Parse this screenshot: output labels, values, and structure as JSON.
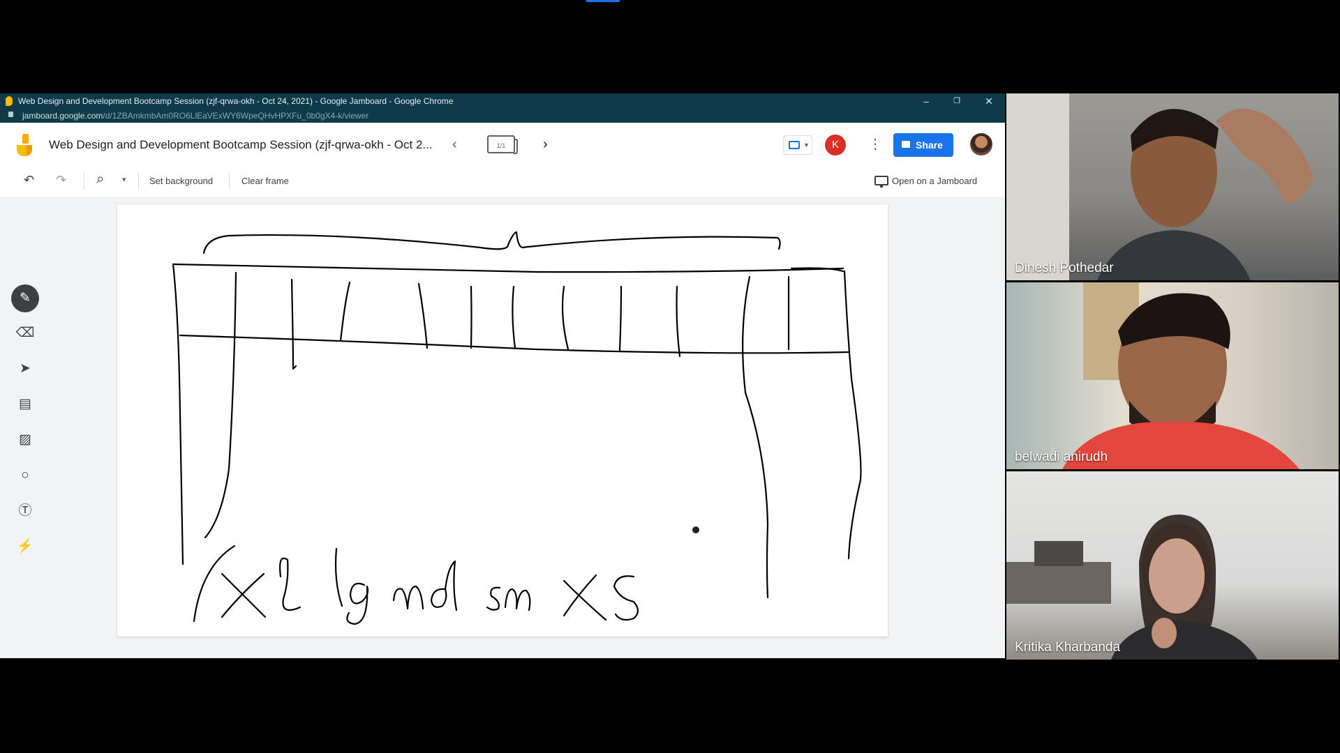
{
  "browser": {
    "window_title": "Web Design and Development Bootcamp Session (zjf-qrwa-okh - Oct 24, 2021) - Google Jamboard - Google Chrome",
    "url_host": "jamboard.google.com",
    "url_path": "/d/1ZBAmkmbAm0RO6LlEaVExWY6WpeQHvHPXFu_0b0gX4-k/viewer",
    "controls": {
      "minimize": "–",
      "restore": "❐",
      "close": "✕"
    }
  },
  "jamboard": {
    "doc_title": "Web Design and Development Bootcamp Session (zjf-qrwa-okh - Oct 2...",
    "frame_counter": "1/1",
    "prev_glyph": "‹",
    "next_glyph": "›",
    "user_initial": "K",
    "more_glyph": "⋮",
    "share_label": "Share",
    "toolbar": {
      "undo_glyph": "↶",
      "redo_glyph": "↷",
      "zoom_glyph": "⌕",
      "zoom_caret": "▾",
      "set_background": "Set background",
      "clear_frame": "Clear frame",
      "open_on_jamboard": "Open on a Jamboard"
    },
    "tools": [
      {
        "name": "pen",
        "glyph": "✎",
        "active": true
      },
      {
        "name": "eraser",
        "glyph": "⌫",
        "active": false
      },
      {
        "name": "select",
        "glyph": "➤",
        "active": false
      },
      {
        "name": "sticky-note",
        "glyph": "▤",
        "active": false
      },
      {
        "name": "image",
        "glyph": "▨",
        "active": false
      },
      {
        "name": "circle",
        "glyph": "○",
        "active": false
      },
      {
        "name": "text-box",
        "glyph": "Ⓣ",
        "active": false
      },
      {
        "name": "laser",
        "glyph": "⚡",
        "active": false
      }
    ],
    "handwriting": [
      "Xl",
      "lg",
      "md",
      "sm",
      "xs"
    ]
  },
  "participants": [
    {
      "name": "Dinesh Pothedar"
    },
    {
      "name": "belwadi anirudh"
    },
    {
      "name": "Kritika Kharbanda"
    }
  ],
  "colors": {
    "accent": "#1a73e8",
    "chrome_bar": "#0f3a4a",
    "avatar_k": "#d93025",
    "ink": "#000000"
  }
}
